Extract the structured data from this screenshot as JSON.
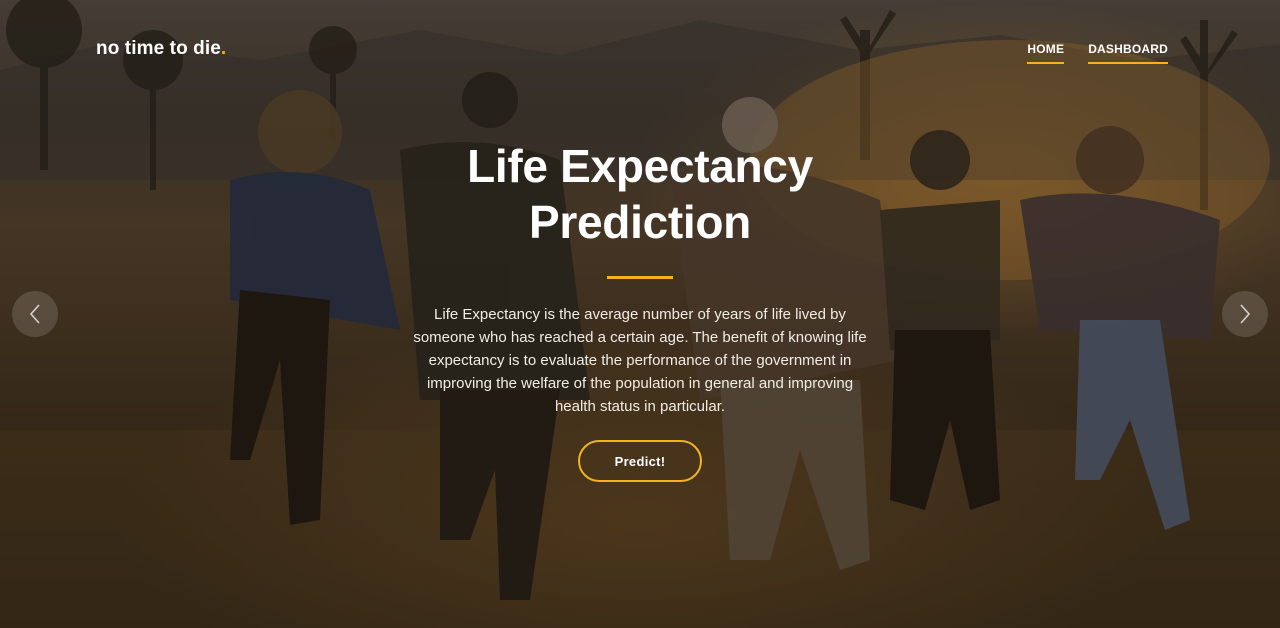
{
  "brand": {
    "name": "no time to die",
    "dot": "."
  },
  "nav": {
    "items": [
      {
        "label": "HOME"
      },
      {
        "label": "DASHBOARD"
      }
    ]
  },
  "hero": {
    "title_line1": "Life Expectancy",
    "title_line2": "Prediction",
    "description": "Life Expectancy is the average number of years of life lived by someone who has reached a certain age. The benefit of knowing life expectancy is to evaluate the performance of the government in improving the welfare of the population in general and improving health status in particular.",
    "button_label": "Predict!"
  },
  "carousel": {
    "prev_icon": "chevron-left-icon",
    "next_icon": "chevron-right-icon"
  },
  "colors": {
    "accent": "#f5b21c",
    "text": "#ffffff"
  }
}
